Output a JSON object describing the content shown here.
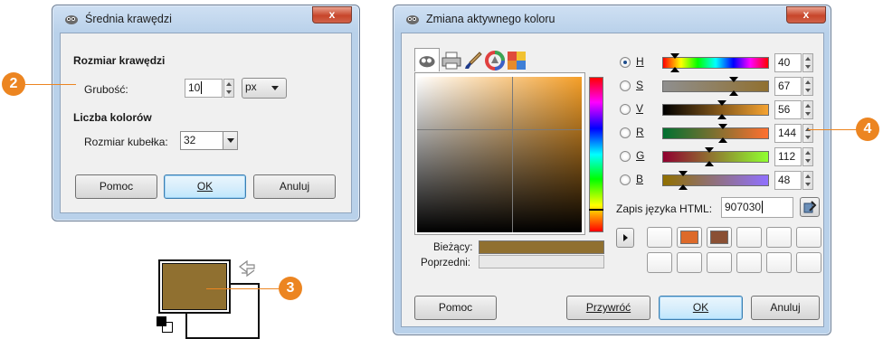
{
  "dialog_edge": {
    "title": "Średnia krawędzi",
    "close_label": "x",
    "section_border": "Rozmiar krawędzi",
    "thickness_label": "Grubość:",
    "thickness_value": "10",
    "unit_value": "px",
    "section_colors": "Liczba kolorów",
    "bucket_label": "Rozmiar kubełka:",
    "bucket_value": "32",
    "buttons": {
      "help": "Pomoc",
      "ok": "OK",
      "cancel": "Anuluj"
    }
  },
  "fg_bg_widget": {
    "foreground_color": "#907030",
    "background_color": "#ffffff"
  },
  "dialog_color": {
    "title": "Zmiana aktywnego koloru",
    "close_label": "x",
    "current_label": "Bieżący:",
    "previous_label": "Poprzedni:",
    "current_color": "#907030",
    "previous_color": "#e8e8e8",
    "channels": [
      {
        "key": "H",
        "value": "40",
        "level": 0.11,
        "selected": true
      },
      {
        "key": "S",
        "value": "67",
        "level": 0.67,
        "selected": false
      },
      {
        "key": "V",
        "value": "56",
        "level": 0.56,
        "selected": false
      },
      {
        "key": "R",
        "value": "144",
        "level": 0.565,
        "selected": false
      },
      {
        "key": "G",
        "value": "112",
        "level": 0.44,
        "selected": false
      },
      {
        "key": "B",
        "value": "48",
        "level": 0.19,
        "selected": false
      }
    ],
    "html_label": "Zapis języka HTML:",
    "html_value": "907030",
    "history_swatches": [
      "",
      "#dd6a2a",
      "#8a5034",
      "",
      "",
      "",
      "",
      "",
      "",
      "",
      "",
      ""
    ],
    "buttons": {
      "help": "Pomoc",
      "reset": "Przywróć",
      "ok": "OK",
      "cancel": "Anuluj"
    }
  },
  "callouts": [
    "2",
    "3",
    "4"
  ],
  "colors": {
    "accent": "#ec8521",
    "selected_color": "#907030"
  }
}
